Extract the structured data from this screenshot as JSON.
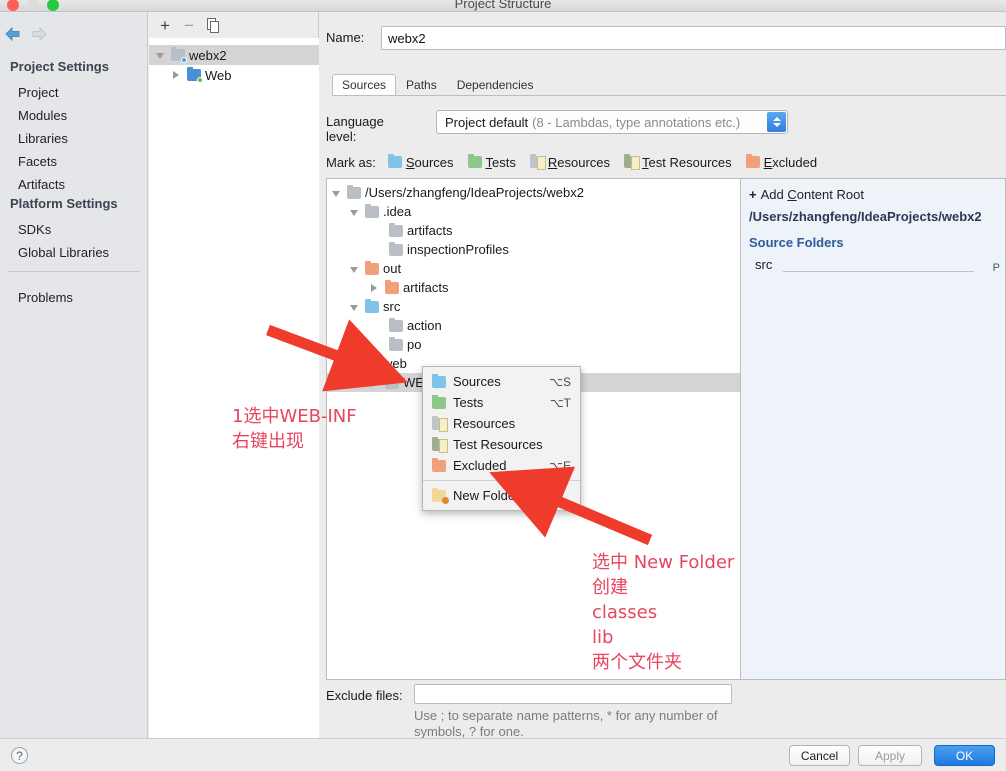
{
  "window": {
    "title": "Project Structure",
    "traffic_lights": [
      "close-red",
      "minimize-disabled",
      "zoom-green"
    ]
  },
  "nav": {
    "back_icon": "back-arrow-icon",
    "forward_icon": "forward-arrow-icon"
  },
  "sidebar": {
    "sections": [
      {
        "title": "Project Settings",
        "items": [
          "Project",
          "Modules",
          "Libraries",
          "Facets",
          "Artifacts"
        ]
      },
      {
        "title": "Platform Settings",
        "items": [
          "SDKs",
          "Global Libraries"
        ]
      }
    ],
    "extra_items": [
      "Problems"
    ]
  },
  "module_panel": {
    "toolbar": {
      "add": "+",
      "remove": "−",
      "copy": "copy-icon"
    },
    "tree": [
      {
        "label": "webx2",
        "indent": 0,
        "twisty": "open",
        "icon": "module-icon",
        "selected": true
      },
      {
        "label": "Web",
        "indent": 1,
        "twisty": "closed",
        "icon": "web-facet-icon",
        "selected": false
      }
    ]
  },
  "main": {
    "name_label": "Name:",
    "name_value": "webx2",
    "tabs": [
      {
        "label": "Sources",
        "active": true
      },
      {
        "label": "Paths",
        "active": false
      },
      {
        "label": "Dependencies",
        "active": false
      }
    ],
    "language_level": {
      "label": "Language level:",
      "value": "Project default",
      "hint": "(8 - Lambdas, type annotations etc.)"
    },
    "mark_as": {
      "label": "Mark as:",
      "options": [
        {
          "label": "Sources",
          "mnemonic": "S",
          "color": "#7fc4e8",
          "icon": "folder-sources-icon"
        },
        {
          "label": "Tests",
          "mnemonic": "T",
          "color": "#8ec78a",
          "icon": "folder-tests-icon"
        },
        {
          "label": "Resources",
          "mnemonic": "R",
          "color": "#bfc5cb",
          "icon": "folder-resources-icon"
        },
        {
          "label": "Test Resources",
          "mnemonic": "T",
          "color": "#9fae8e",
          "icon": "folder-test-resources-icon"
        },
        {
          "label": "Excluded",
          "mnemonic": "E",
          "color": "#f1a07a",
          "icon": "folder-excluded-icon"
        }
      ]
    },
    "content_tree": [
      {
        "label": "/Users/zhangfeng/IdeaProjects/webx2",
        "indent": 0,
        "twisty": "open",
        "color": "gray",
        "selected": false
      },
      {
        "label": ".idea",
        "indent": 1,
        "twisty": "open",
        "color": "gray",
        "selected": false
      },
      {
        "label": "artifacts",
        "indent": 2,
        "twisty": "none",
        "color": "gray",
        "selected": false
      },
      {
        "label": "inspectionProfiles",
        "indent": 2,
        "twisty": "none",
        "color": "gray",
        "selected": false
      },
      {
        "label": "out",
        "indent": 1,
        "twisty": "open",
        "color": "orange",
        "selected": false
      },
      {
        "label": "artifacts",
        "indent": 2,
        "twisty": "closed",
        "color": "orange",
        "selected": false
      },
      {
        "label": "src",
        "indent": 1,
        "twisty": "open",
        "color": "blue",
        "selected": false
      },
      {
        "label": "action",
        "indent": 2,
        "twisty": "none",
        "color": "gray",
        "selected": false
      },
      {
        "label": "po",
        "indent": 2,
        "twisty": "none",
        "color": "gray",
        "selected": false
      },
      {
        "label": "web",
        "indent": 1,
        "twisty": "open",
        "color": "gray",
        "selected": false
      },
      {
        "label": "WEB-INF",
        "indent": 2,
        "twisty": "closed",
        "color": "gray",
        "selected": true
      }
    ],
    "content_roots": {
      "add_label": "Add Content Root",
      "add_mnemonic": "C",
      "root_path": "/Users/zhangfeng/IdeaProjects/webx2",
      "source_folders_title": "Source Folders",
      "source_folders": [
        {
          "name": "src",
          "right": "P"
        }
      ]
    },
    "exclude": {
      "label": "Exclude files:",
      "value": "",
      "hint": "Use ; to separate name patterns, * for any number of symbols, ? for one."
    }
  },
  "context_menu": {
    "items": [
      {
        "label": "Sources",
        "shortcut": "⌥S",
        "icon": "folder-sources-icon"
      },
      {
        "label": "Tests",
        "shortcut": "⌥T",
        "icon": "folder-tests-icon"
      },
      {
        "label": "Resources",
        "shortcut": "",
        "icon": "folder-resources-icon"
      },
      {
        "label": "Test Resources",
        "shortcut": "",
        "icon": "folder-test-resources-icon"
      },
      {
        "label": "Excluded",
        "shortcut": "⌥E",
        "icon": "folder-excluded-icon"
      }
    ],
    "footer_items": [
      {
        "label": "New Folder...",
        "shortcut": "",
        "icon": "new-folder-icon"
      }
    ]
  },
  "annotations": {
    "color": "#e8455f",
    "note1": "1选中WEB-INF\n右键出现",
    "note2": "选中 New Folder\n创建\nclasses\nlib\n两个文件夹",
    "arrows": [
      "arrow-to-webinf",
      "arrow-to-new-folder"
    ]
  },
  "footer": {
    "help": "?",
    "cancel": "Cancel",
    "apply": "Apply",
    "ok": "OK"
  }
}
